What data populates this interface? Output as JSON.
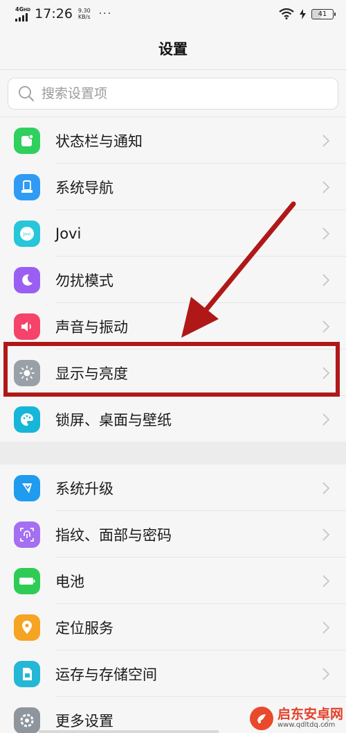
{
  "status_bar": {
    "network": "4G",
    "hd": "HD",
    "time": "17:26",
    "speed_value": "9.30",
    "speed_unit": "KB/s",
    "more": "···",
    "battery": "41"
  },
  "header": {
    "title": "设置"
  },
  "search": {
    "placeholder": "搜索设置项"
  },
  "group1": [
    {
      "label": "状态栏与通知",
      "icon": "status-bar-icon",
      "color": "#2fd05d"
    },
    {
      "label": "系统导航",
      "icon": "navigation-icon",
      "color": "#2f9bf5"
    },
    {
      "label": "Jovi",
      "icon": "jovi-icon",
      "color": "#27c6d9"
    },
    {
      "label": "勿扰模式",
      "icon": "moon-icon",
      "color": "#9a5ff2"
    },
    {
      "label": "声音与振动",
      "icon": "speaker-icon",
      "color": "#f5436b"
    },
    {
      "label": "显示与亮度",
      "icon": "brightness-icon",
      "color": "#9aa0a8"
    },
    {
      "label": "锁屏、桌面与壁纸",
      "icon": "palette-icon",
      "color": "#16b6d9"
    }
  ],
  "group2": [
    {
      "label": "系统升级",
      "icon": "upgrade-icon",
      "color": "#1f9bf0"
    },
    {
      "label": "指纹、面部与密码",
      "icon": "fingerprint-icon",
      "color": "#a56ff2"
    },
    {
      "label": "电池",
      "icon": "battery-icon",
      "color": "#2ecc55"
    },
    {
      "label": "定位服务",
      "icon": "location-icon",
      "color": "#f5a423"
    },
    {
      "label": "运存与存储空间",
      "icon": "storage-icon",
      "color": "#25b7d6"
    },
    {
      "label": "更多设置",
      "icon": "more-settings-icon",
      "color": "#8f959c"
    }
  ],
  "annotation": {
    "highlight_color": "#b01818"
  },
  "watermark": {
    "name": "启东安卓网",
    "url": "www.qdltdq.com"
  }
}
